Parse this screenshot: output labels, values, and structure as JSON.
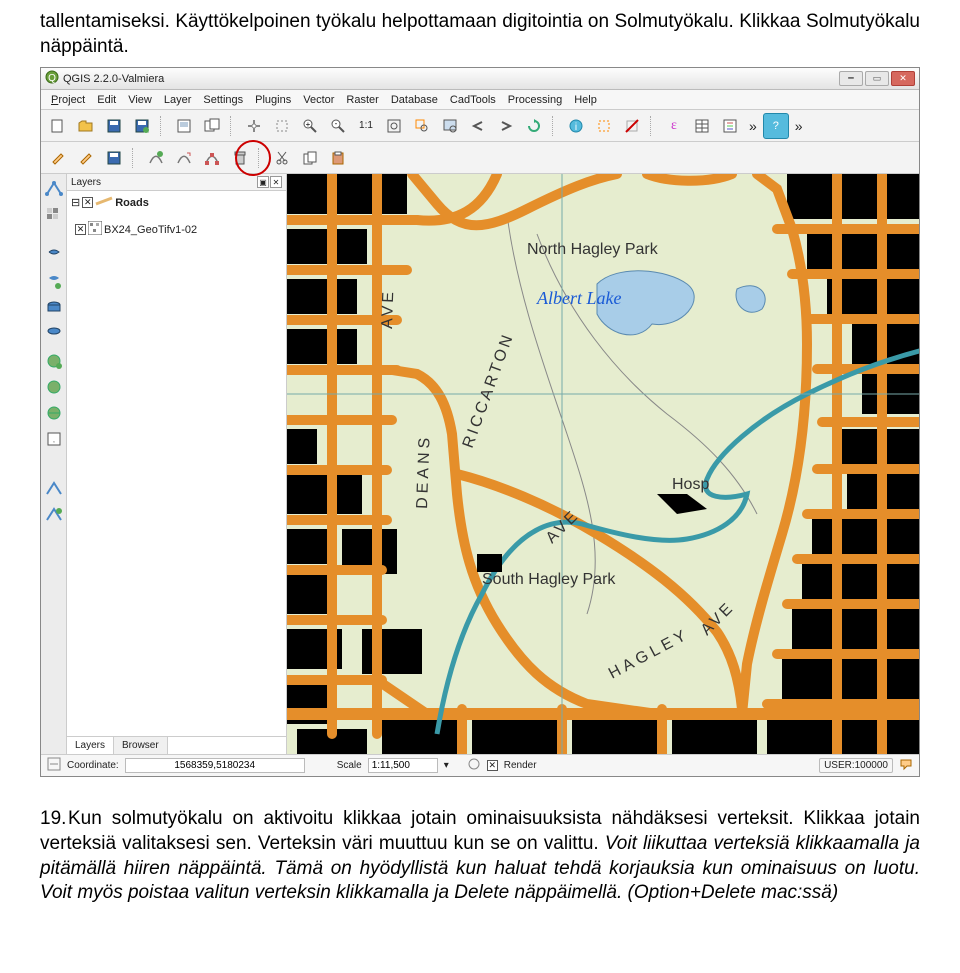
{
  "intro_text": "tallentamiseksi. Käyttökelpoinen työkalu helpottamaan digitointia on Solmutyökalu. Klikkaa Solmutyökalu näppäintä.",
  "window": {
    "title": "QGIS 2.2.0-Valmiera"
  },
  "menu": {
    "project": "Project",
    "edit": "Edit",
    "view": "View",
    "layer": "Layer",
    "settings": "Settings",
    "plugins": "Plugins",
    "vector": "Vector",
    "raster": "Raster",
    "database": "Database",
    "cadtools": "CadTools",
    "processing": "Processing",
    "help": "Help"
  },
  "chevrons": "»",
  "layers_panel": {
    "title": "Layers",
    "roads": "Roads",
    "raster_layer": "BX24_GeoTifv1-02",
    "tab_layers": "Layers",
    "tab_browser": "Browser"
  },
  "map_labels": {
    "north_hagley": "North Hagley Park",
    "albert": "Albert Lake",
    "south_hagley": "South Hagley Park",
    "deans": "DEANS",
    "ave1": "AVE",
    "riccarton": "RICCARTON",
    "ave2": "AVE",
    "hagley": "HAGLEY",
    "ave3": "AVE",
    "hosp": "Hosp"
  },
  "status": {
    "coord_label": "Coordinate:",
    "coord_value": "1568359,5180234",
    "scale_label": "Scale",
    "scale_value": "1:11,500",
    "render_label": "Render",
    "user_label": "USER:100000"
  },
  "outro": {
    "num": "19.",
    "body_a": "Kun solmutyökalu on aktivoitu klikkaa jotain ominaisuuksista nähdäksesi verteksit. Klikkaa jotain verteksiä valitaksesi sen. Verteksin väri muuttuu kun se on valittu. ",
    "body_i": "Voit liikuttaa verteksiä klikkaamalla ja pitämällä hiiren näppäintä. Tämä on hyödyllistä kun haluat tehdä korjauksia kun ominaisuus on luotu. Voit myös poistaa valitun verteksin klikkamalla ja Delete näppäimellä. (Option+Delete mac:ssä)"
  }
}
